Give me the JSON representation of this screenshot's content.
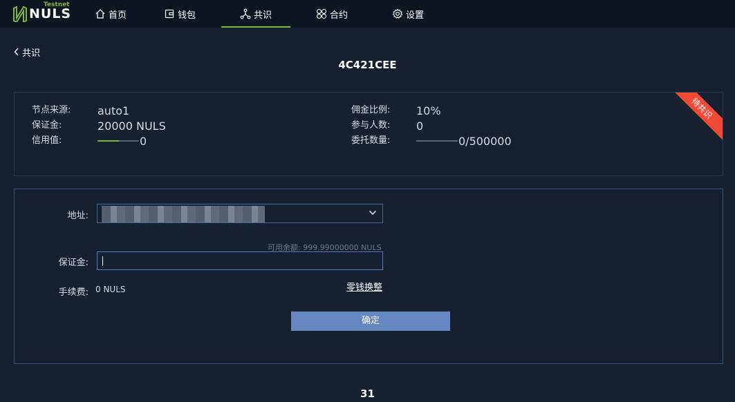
{
  "app": {
    "brand": "NULS",
    "env_badge": "Testnet",
    "accent_color": "#7fb53a"
  },
  "nav": {
    "items": [
      {
        "label": "首页",
        "icon": "home-icon"
      },
      {
        "label": "钱包",
        "icon": "wallet-icon"
      },
      {
        "label": "共识",
        "icon": "consensus-icon",
        "active": true
      },
      {
        "label": "合约",
        "icon": "contract-icon"
      },
      {
        "label": "设置",
        "icon": "gear-icon"
      }
    ]
  },
  "back_link": {
    "label": "共识",
    "icon": "chevron-left-icon"
  },
  "page_title": "4C421CEE",
  "node_info": {
    "ribbon": "待共识",
    "ribbon_color": "#f04a37",
    "source_label": "节点来源:",
    "source_value": "auto1",
    "deposit_label": "保证金:",
    "deposit_value": "20000 NULS",
    "credit_label": "信用值:",
    "credit_value": "0",
    "credit_fill_fraction": 0.52,
    "commission_label": "佣金比例:",
    "commission_value": "10%",
    "participants_label": "参与人数:",
    "participants_value": "0",
    "delegation_label": "委托数量:",
    "delegation_value": "0/500000",
    "delegation_fill_fraction": 0.0
  },
  "form": {
    "address_label": "地址:",
    "available_balance": "可用余额: 999.99000000 NULS",
    "deposit_label": "保证金:",
    "deposit_value": "",
    "fee_label": "手续费:",
    "fee_value": "0 NULS",
    "change_link": "零钱换整",
    "confirm_label": "确定",
    "confirm_color": "#6687c2"
  },
  "footer_number": "31"
}
